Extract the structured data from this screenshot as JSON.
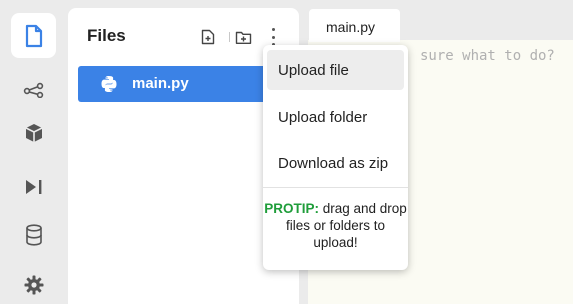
{
  "files_panel": {
    "title": "Files",
    "new_file_tooltip_icon": "add-file-icon",
    "new_folder_tooltip_icon": "add-folder-icon",
    "files": [
      {
        "name": "main.py",
        "icon": "python-icon",
        "selected": true
      }
    ]
  },
  "editor": {
    "tabs": [
      {
        "label": "main.py"
      }
    ],
    "hint": "sure what to do?"
  },
  "menu": {
    "items": [
      {
        "label": "Upload file"
      },
      {
        "label": "Upload folder"
      },
      {
        "label": "Download as zip"
      }
    ],
    "protip_tag": "PROTIP:",
    "protip_text": " drag and drop files or folders to upload!"
  },
  "rail": {
    "items": [
      "file-icon",
      "share-icon",
      "package-icon",
      "run-icon",
      "database-icon",
      "settings-icon"
    ]
  },
  "colors": {
    "accent": "#3b82e6",
    "protip": "#1f9d3a"
  }
}
